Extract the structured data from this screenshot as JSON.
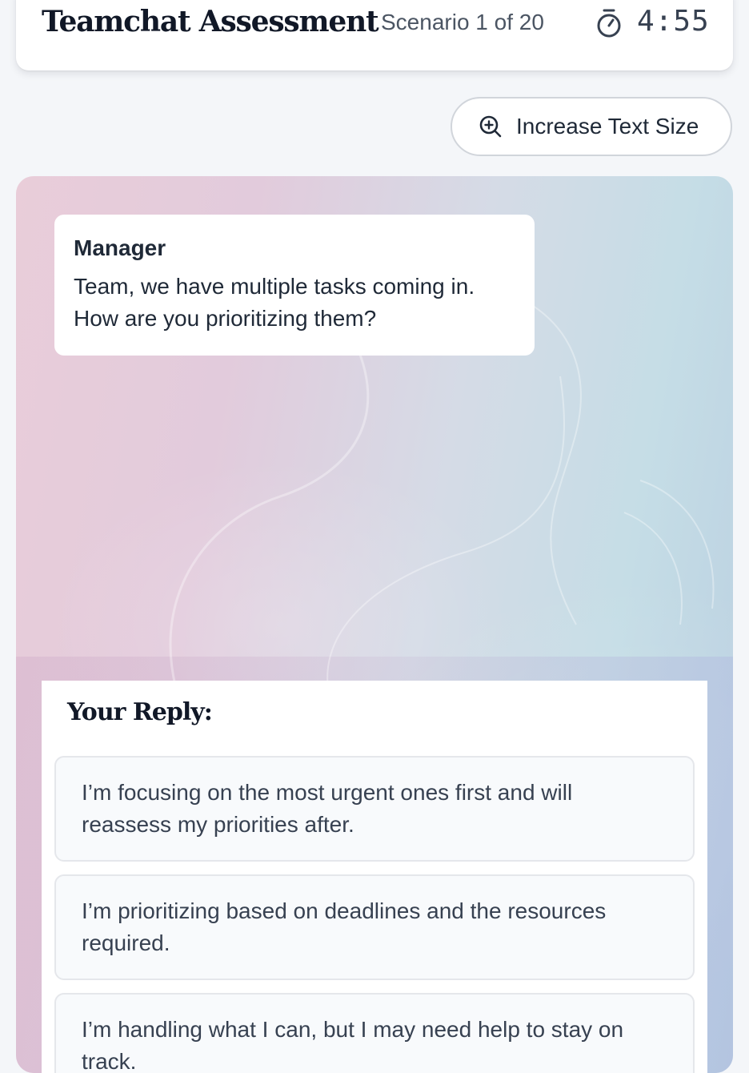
{
  "header": {
    "app_title": "Teamchat Assessment",
    "scenario_progress": "Scenario 1 of 20",
    "timer_icon": "stopwatch-icon",
    "timer_value": "4:55"
  },
  "toolbar": {
    "text_size_icon": "zoom-in-icon",
    "text_size_label": "Increase Text Size"
  },
  "chat": {
    "messages": [
      {
        "sender": "Manager",
        "text": "Team, we have multiple tasks coming in. How are you prioritizing them?"
      }
    ]
  },
  "reply": {
    "heading": "Your Reply:",
    "options": [
      {
        "label": "I’m focusing on the most urgent ones first and will reassess my priorities after."
      },
      {
        "label": "I’m prioritizing based on deadlines and the resources required."
      },
      {
        "label": "I’m handling what I can, but I may need help to stay on track."
      }
    ]
  },
  "colors": {
    "background": "#f4f6f9",
    "card": "#ffffff",
    "option_background": "#f8fafc",
    "option_border": "#e5e7eb",
    "gradient_pink": "#e9cdd9",
    "gradient_blue": "#b9cee0"
  }
}
